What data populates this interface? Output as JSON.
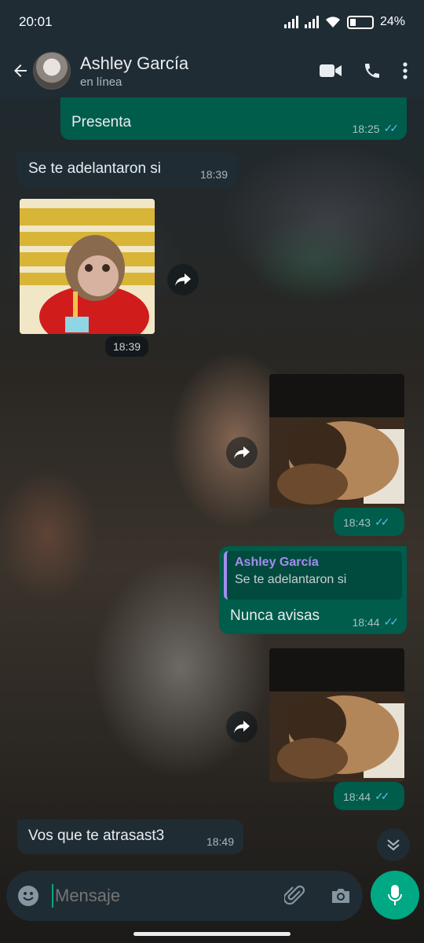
{
  "status_bar": {
    "time": "20:01",
    "battery": "24%"
  },
  "header": {
    "contact_name": "Ashley García",
    "contact_status": "en línea"
  },
  "messages": [
    {
      "id": "m1",
      "type": "text",
      "direction": "out",
      "text": "Presenta",
      "time": "18:25",
      "read": true
    },
    {
      "id": "m2",
      "type": "text",
      "direction": "in",
      "text": "Se te adelantaron si",
      "time": "18:39"
    },
    {
      "id": "m3",
      "type": "sticker",
      "direction": "in",
      "description": "monkey in red hoodie",
      "time": "18:39"
    },
    {
      "id": "m4",
      "type": "image",
      "direction": "out",
      "time": "18:43",
      "read": true
    },
    {
      "id": "m5",
      "type": "reply",
      "direction": "out",
      "quoted_author": "Ashley García",
      "quoted_text": "Se te adelantaron si",
      "text": "Nunca avisas",
      "time": "18:44",
      "read": true
    },
    {
      "id": "m6",
      "type": "image",
      "direction": "out",
      "time": "18:44",
      "read": true
    },
    {
      "id": "m7",
      "type": "text",
      "direction": "in",
      "text": "Vos que te atrasast3",
      "time": "18:49"
    }
  ],
  "composer": {
    "placeholder": "Mensaje"
  },
  "colors": {
    "outgoing": "#005c4b",
    "incoming": "#1f2c34",
    "accent": "#00a884",
    "read_ticks": "#53bdeb",
    "quote_author": "#a38df0"
  },
  "icons": [
    "back-arrow-icon",
    "video-call-icon",
    "phone-icon",
    "more-options-icon",
    "forward-icon",
    "emoji-icon",
    "attach-icon",
    "camera-icon",
    "mic-icon",
    "chevron-down-icon"
  ]
}
